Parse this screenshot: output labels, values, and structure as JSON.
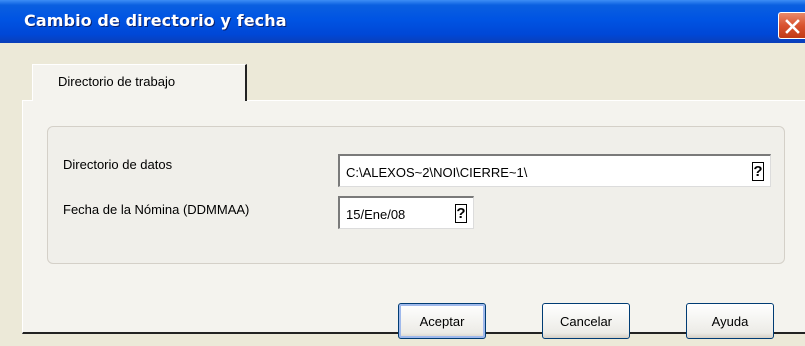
{
  "window": {
    "title": "Cambio de directorio y fecha",
    "close_icon": "close-icon",
    "colors": {
      "titlebar": "#0054e3",
      "close": "#d9532f",
      "face": "#ece9d8"
    }
  },
  "tabs": [
    {
      "label": "Directorio de trabajo",
      "selected": true
    }
  ],
  "form": {
    "directory_label": "Directorio de datos",
    "directory_value": "C:\\ALEXOS~2\\NOI\\CIERRE~1\\",
    "date_label": "Fecha de la Nómina (DDMMAA)",
    "date_value": "15/Ene/08",
    "help_glyph": "?"
  },
  "buttons": {
    "accept": "Aceptar",
    "cancel": "Cancelar",
    "help": "Ayuda"
  }
}
